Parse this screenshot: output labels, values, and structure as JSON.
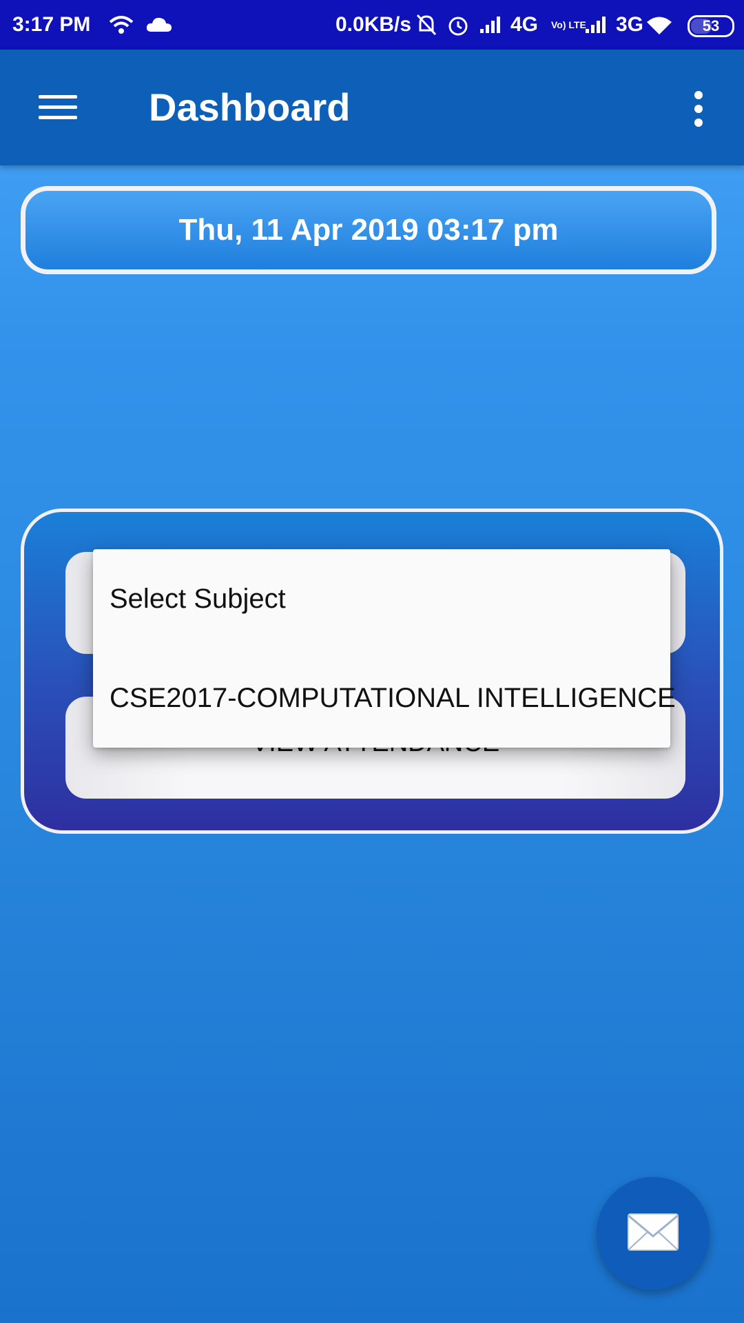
{
  "status_bar": {
    "time": "3:17 PM",
    "speed": "0.0KB/s",
    "network1": "4G",
    "volte": "Vo) LTE",
    "network2": "3G",
    "battery": "53",
    "icons": [
      "wifi-icon",
      "cloud-icon",
      "bell-muted-icon",
      "alarm-icon",
      "signal-icon",
      "signal-icon",
      "wifi-icon",
      "battery-icon"
    ]
  },
  "app_bar": {
    "title": "Dashboard",
    "icons": [
      "menu-icon",
      "overflow-menu-icon"
    ]
  },
  "date_display": "Thu, 11 Apr 2019 03:17 pm",
  "card": {
    "button_1_label": "",
    "button_2_label": "VIEW ATTENDANCE"
  },
  "dropdown": {
    "options": [
      "Select Subject",
      "CSE2017-COMPUTATIONAL INTELLIGENCE"
    ]
  },
  "fab": {
    "icon": "mail-icon"
  },
  "colors": {
    "status_bar": "#0e12b8",
    "app_bar": "#0e5fb8",
    "background": "#2886dc",
    "fab": "#0f5cba"
  }
}
